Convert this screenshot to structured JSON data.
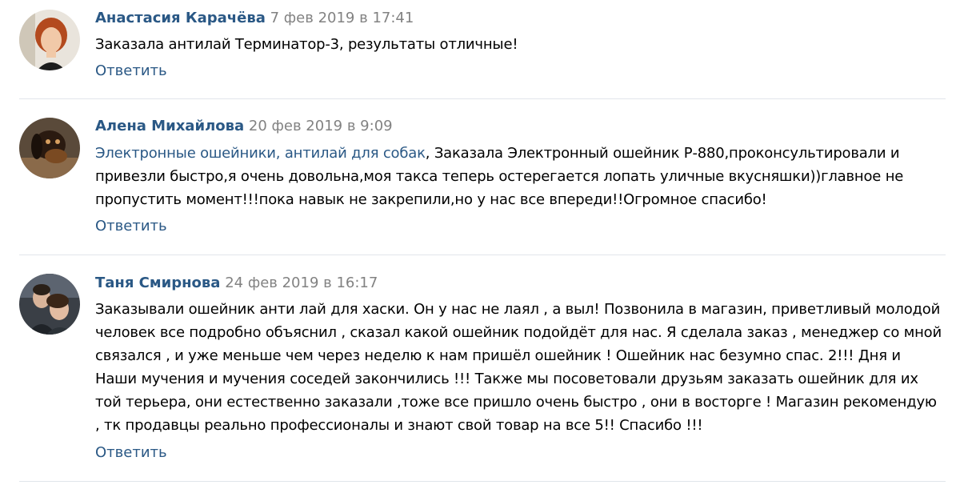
{
  "comments": [
    {
      "author": "Анастасия Карачёва",
      "date": "7 фев 2019 в 17:41",
      "text": "Заказала антилай Терминатор-3, результаты отличные!",
      "reply_label": "Ответить",
      "avatar_icon": "user-avatar-woman-red-hair"
    },
    {
      "author": "Алена Михайлова",
      "date": "20 фев 2019 в 9:09",
      "mention": "Электронные ошейники, антилай для собак",
      "text_line1": ", Заказала Электронный ошейник Р-880,проконсультировали и",
      "text_line2": "привезли быстро,я очень довольна,моя такса теперь остерегается лопать уличные вкусняшки))главное не",
      "text_line3": "пропустить момент!!!пока навык не закрепили,но у нас все впереди!!Огромное спасибо!",
      "reply_label": "Ответить",
      "avatar_icon": "dachshund-avatar"
    },
    {
      "author": "Таня Смирнова",
      "date": "24 фев 2019 в 16:17",
      "lines": [
        "Заказывали ошейник анти лай для хаски. Он у нас не лаял , а выл! Позвонила в магазин, приветливый молодой",
        "человек все подробно объяснил , сказал какой ошейник подойдёт для нас. Я сделала заказ , менеджер со мной",
        "связался , и уже меньше чем через неделю к нам пришёл ошейник ! Ошейник нас безумно спас. 2!!! Дня и",
        "Наши мучения и мучения соседей закончились !!! Также мы посоветовали друзьям заказать ошейник для их",
        "той терьера, они естественно заказали ,тоже все пришло очень быстро , они в восторге ! Магазин рекомендую",
        ", тк продавцы реально профессионалы и знают свой товар на все 5!! Спасибо !!!"
      ],
      "reply_label": "Ответить",
      "avatar_icon": "couple-photo-avatar"
    }
  ],
  "colors": {
    "author": "#2a5885",
    "date": "#828282",
    "link": "#2a5885",
    "divider": "#e1e5eb"
  }
}
